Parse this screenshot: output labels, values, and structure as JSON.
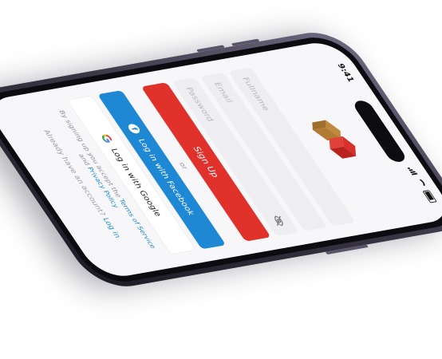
{
  "status_bar": {
    "time": "9:41"
  },
  "form": {
    "fullname_placeholder": "Fullname",
    "email_placeholder": "Email",
    "password_placeholder": "Password",
    "signup_label": "Sign Up",
    "divider_text": "or",
    "facebook_label": "Log in with Facebook",
    "google_label": "Log in with Google",
    "terms_prefix": "By signing up you accept the",
    "terms_link": "Terms of Service",
    "terms_and": "and",
    "privacy_link": "Privacy Policy",
    "account_prompt": "Already have an account?",
    "login_link": "Log in"
  },
  "colors": {
    "signup": "#e0312b",
    "facebook": "#1e88d5",
    "link": "#1e88d5",
    "logo_gold": "#c08a3e",
    "logo_red": "#d9302b"
  }
}
